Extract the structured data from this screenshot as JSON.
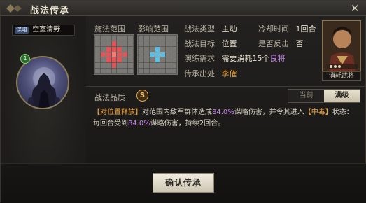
{
  "window": {
    "title": "战法传承",
    "close_label": "✕"
  },
  "skill": {
    "type_tag": "谋略",
    "name": "空室清野",
    "level": "1"
  },
  "range": {
    "cast_range_label": "施法范围",
    "effect_range_label": "影响范围"
  },
  "info": {
    "type_label": "战法类型",
    "type_value": "主动",
    "cooldown_label": "冷却时间",
    "cooldown_value": "1回合",
    "target_label": "战法目标",
    "target_value": "位置",
    "counter_label": "是否反击",
    "counter_value": "否",
    "train_label": "演练需求",
    "train_value_prefix": "需要消耗15个",
    "train_value_highlight": "良将",
    "source_label": "传承出处",
    "source_value": "李傕"
  },
  "general_card": {
    "label": "消耗武将"
  },
  "quality": {
    "label": "战法品质",
    "grade": "S"
  },
  "toggle": {
    "current_label": "当前",
    "max_label": "满级"
  },
  "description": {
    "part1": "【对位置释放】",
    "part2": "对范围内敌军群体造成",
    "pct1": "84.0%",
    "part3": "谋略伤害，并令其进入",
    "status": "【中毒】",
    "part4": "状态：每回合受到",
    "pct2": "84.0%",
    "part5": "谋略伤害，持续2回合。"
  },
  "footer": {
    "confirm_label": "确认传承"
  },
  "colors": {
    "accent_orange": "#f0a33a",
    "accent_purple": "#c98bf0",
    "range_red": "#e25458",
    "range_blue": "#57c1e8"
  }
}
